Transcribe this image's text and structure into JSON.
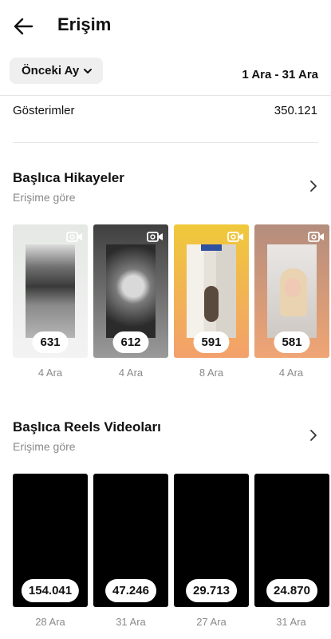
{
  "header": {
    "title": "Erişim"
  },
  "filter": {
    "period_label": "Önceki Ay",
    "date_range": "1 Ara - 31 Ara"
  },
  "impressions": {
    "label": "Gösterimler",
    "value": "350.121"
  },
  "stories": {
    "title": "Başlıca Hikayeler",
    "subtitle": "Erişime göre",
    "items": [
      {
        "count": "631",
        "date": "4 Ara",
        "bg_top": "#e5e8e5",
        "bg_bottom": "#f3f3f3",
        "thumb_style": "ocean"
      },
      {
        "count": "612",
        "date": "4 Ara",
        "bg_top": "#3f3f3f",
        "bg_bottom": "#9a9a9a",
        "thumb_style": "portrait-bw"
      },
      {
        "count": "591",
        "date": "8 Ara",
        "bg_top": "#f0c93a",
        "bg_bottom": "#f3a06b",
        "thumb_style": "selfie-room"
      },
      {
        "count": "581",
        "date": "4 Ara",
        "bg_top": "#b48d7e",
        "bg_bottom": "#f0a574",
        "thumb_style": "portrait-blonde"
      }
    ]
  },
  "reels": {
    "title": "Başlıca Reels Videoları",
    "subtitle": "Erişime göre",
    "items": [
      {
        "count": "154.041",
        "date": "28 Ara"
      },
      {
        "count": "47.246",
        "date": "31 Ara"
      },
      {
        "count": "29.713",
        "date": "27 Ara"
      },
      {
        "count": "24.870",
        "date": "31 Ara"
      }
    ]
  },
  "icons": {
    "back": "arrow-left-icon",
    "period_dropdown": "chevron-down-icon",
    "section_more": "chevron-right-icon",
    "story_type": "video-camera-icon"
  }
}
